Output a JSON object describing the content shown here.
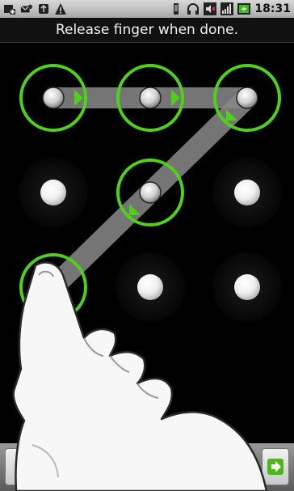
{
  "status_bar": {
    "left_icons": [
      "add-notification-icon",
      "missed-call-icon",
      "usb-debug-icon",
      "warning-icon"
    ],
    "right_icons": [
      "vibrate-icon",
      "headset-icon",
      "mute-icon",
      "signal-icon",
      "battery-icon"
    ],
    "time": "18:31"
  },
  "header": {
    "instruction": "Release finger when done."
  },
  "pattern": {
    "selected_sequence": [
      1,
      2,
      3,
      5,
      7
    ],
    "colors": {
      "accent": "#4fd01a",
      "path": "#8a8a8a"
    }
  },
  "bottom_bar": {
    "left_button_label": "",
    "right_button_icon": "next-arrow-icon"
  }
}
